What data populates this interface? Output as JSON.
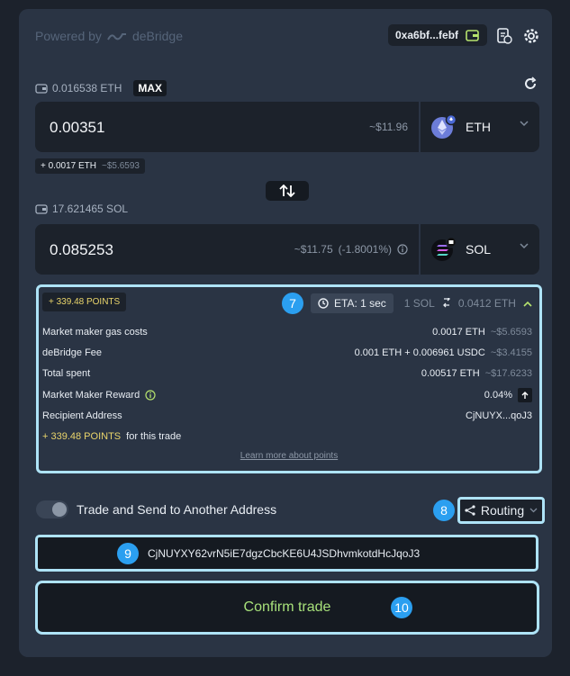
{
  "header": {
    "powered_by": "Powered by",
    "brand": "deBridge",
    "wallet_address": "0xa6bf...febf"
  },
  "from": {
    "balance": "0.016538 ETH",
    "max_label": "MAX",
    "amount": "0.00351",
    "usd": "~$11.96",
    "token": "ETH",
    "gas_amount": "+ 0.0017 ETH",
    "gas_usd": "~$5.6593"
  },
  "to": {
    "balance": "17.621465 SOL",
    "amount": "0.085253",
    "usd": "~$11.75",
    "usd_change": "(-1.8001%)",
    "token": "SOL"
  },
  "details": {
    "points_badge": "+ 339.48 POINTS",
    "badge_7": "7",
    "eta": "ETA: 1 sec",
    "rate_left": "1 SOL",
    "rate_right": "0.0412 ETH",
    "rows": [
      {
        "label": "Market maker gas costs",
        "value": "0.0017 ETH",
        "usd": "~$5.6593"
      },
      {
        "label": "deBridge Fee",
        "value": "0.001 ETH + 0.006961 USDC",
        "usd": "~$3.4155"
      },
      {
        "label": "Total spent",
        "value": "0.00517 ETH",
        "usd": "~$17.6233"
      },
      {
        "label": "Market Maker Reward",
        "value": "0.04%"
      },
      {
        "label": "Recipient Address",
        "value": "CjNUYX...qoJ3"
      }
    ],
    "points_line": "+ 339.48 POINTS",
    "points_suffix": "for this trade",
    "learn_more": "Learn more about points"
  },
  "controls": {
    "send_label": "Trade and Send to Another Address",
    "badge_8": "8",
    "routing_label": "Routing",
    "badge_9": "9",
    "recipient": "CjNUYXY62vrN5iE7dgzCbcKE6U4JSDhvmkotdHcJqoJ3",
    "confirm_label": "Confirm trade",
    "badge_10": "10"
  },
  "colors": {
    "accent_highlight": "#aee3f7",
    "badge_blue": "#2b9ff0",
    "points_yellow": "#ead56b",
    "confirm_green": "#a7e07a"
  }
}
